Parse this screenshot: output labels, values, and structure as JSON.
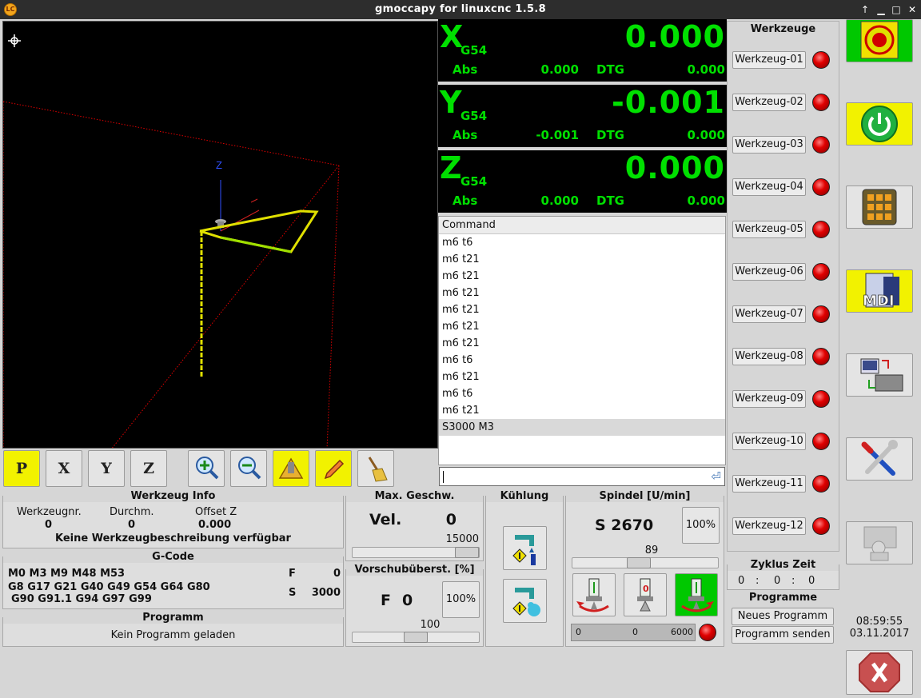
{
  "window": {
    "title": "gmoccapy for linuxcnc  1.5.8"
  },
  "dro": [
    {
      "axis": "X",
      "system": "G54",
      "value": "0.000",
      "abs_label": "Abs",
      "abs": "0.000",
      "dtg_label": "DTG",
      "dtg": "0.000"
    },
    {
      "axis": "Y",
      "system": "G54",
      "value": "-0.001",
      "abs_label": "Abs",
      "abs": "-0.001",
      "dtg_label": "DTG",
      "dtg": "0.000"
    },
    {
      "axis": "Z",
      "system": "G54",
      "value": "0.000",
      "abs_label": "Abs",
      "abs": "0.000",
      "dtg_label": "DTG",
      "dtg": "0.000"
    }
  ],
  "history": {
    "header": "Command",
    "items": [
      "m6 t6",
      "m6 t21",
      "m6 t21",
      "m6 t21",
      "m6 t21",
      "m6 t21",
      "m6 t21",
      "m6 t6",
      "m6 t21",
      "m6 t6",
      "m6 t21",
      "S3000 M3"
    ],
    "selected_index": 11
  },
  "preview": {
    "axis_label": "Z"
  },
  "view_buttons": [
    "P",
    "X",
    "Y",
    "Z"
  ],
  "tool_info": {
    "title": "Werkzeug Info",
    "col1_label": "Werkzeugnr.",
    "col1_value": "0",
    "col2_label": "Durchm.",
    "col2_value": "0",
    "col3_label": "Offset Z",
    "col3_value": "0.000",
    "description": "Keine Werkzeugbeschreibung verfügbar"
  },
  "gcode": {
    "title": "G-Code",
    "line1": "M0 M3 M9 M48 M53",
    "line2": "G8 G17 G21 G40 G49 G54 G64 G80",
    "line3": "G90 G91.1 G94 G97 G99",
    "f_label": "F",
    "f_value": "0",
    "s_label": "S",
    "s_value": "3000"
  },
  "program": {
    "title": "Programm",
    "status": "Kein Programm geladen"
  },
  "max_vel": {
    "title": "Max. Geschw.",
    "label": "Vel.",
    "value": "0",
    "max": "15000",
    "slider_fraction": 1.0
  },
  "feed_override": {
    "title": "Vorschubüberst. [%]",
    "label": "F",
    "value": "0",
    "reset_button": "100%",
    "scale_label": "100",
    "slider_fraction": 0.5
  },
  "cooling": {
    "title": "Kühlung"
  },
  "spindle": {
    "title": "Spindel [U/min]",
    "speed_label": "S 2670",
    "reset_button": "100%",
    "override_value": "89",
    "override_fraction": 0.45,
    "bar_min": "0",
    "bar_value": "0",
    "bar_max": "6000"
  },
  "tools": {
    "title": "Werkzeuge",
    "items": [
      "Werkzeug-01",
      "Werkzeug-02",
      "Werkzeug-03",
      "Werkzeug-04",
      "Werkzeug-05",
      "Werkzeug-06",
      "Werkzeug-07",
      "Werkzeug-08",
      "Werkzeug-09",
      "Werkzeug-10",
      "Werkzeug-11",
      "Werkzeug-12"
    ]
  },
  "cycle_time": {
    "title": "Zyklus Zeit",
    "h": "0",
    "m": "0",
    "s": "0",
    "sep": ":"
  },
  "programs": {
    "title": "Programme",
    "new_button": "Neues Programm",
    "send_button": "Programm senden"
  },
  "clock": {
    "time": "08:59:55",
    "date": "03.11.2017"
  },
  "side_buttons": {
    "mdi_label": "MDI"
  },
  "colors": {
    "dro_green": "#00e000",
    "estop_green": "#00c800",
    "power_yellow": "#f2f200",
    "led_red": "#e00000",
    "path_yellow": "#e0e000"
  }
}
